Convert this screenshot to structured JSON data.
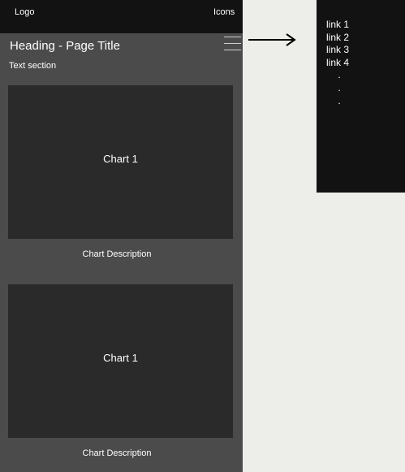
{
  "topbar": {
    "logo": "Logo",
    "icons": "Icons"
  },
  "header": {
    "title": "Heading - Page Title",
    "menu_icon": "hamburger-menu-icon"
  },
  "main": {
    "text_section": "Text section",
    "charts": [
      {
        "title": "Chart 1",
        "description": "Chart Description"
      },
      {
        "title": "Chart 1",
        "description": "Chart Description"
      }
    ]
  },
  "menu": {
    "links": [
      "link 1",
      "link 2",
      "link 3",
      "link 4"
    ],
    "dots": [
      ".",
      ".",
      "."
    ]
  },
  "colors": {
    "background": "#ededE9",
    "phone_body": "#4b4b4b",
    "bar_dark": "#121212",
    "chart_box": "#2a2a2a",
    "text": "#ffffff",
    "arrow": "#000000"
  }
}
